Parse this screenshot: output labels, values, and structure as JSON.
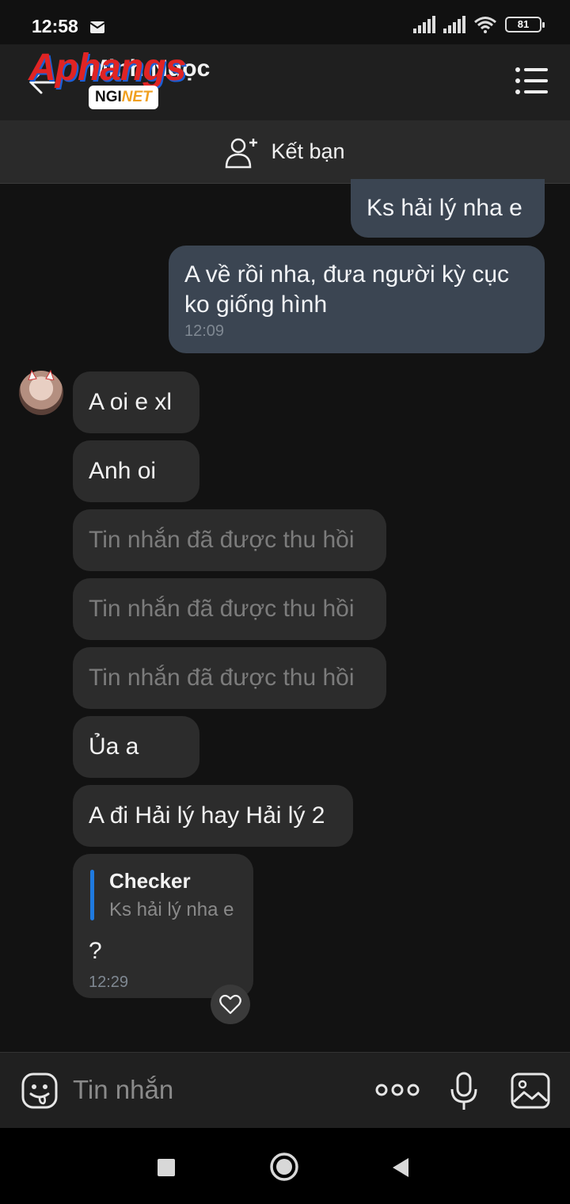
{
  "status": {
    "time": "12:58",
    "battery": "81"
  },
  "header": {
    "contact_name": "Minh Ngọc",
    "watermark": "Aphangs",
    "watermark_badge_prefix": "NGI",
    "watermark_badge_suffix": "NET"
  },
  "friend_bar": {
    "label": "Kết bạn"
  },
  "messages": [
    {
      "dir": "out",
      "text": "Ks hải lý nha e"
    },
    {
      "dir": "out",
      "text": "A về rồi nha, đưa người kỳ cục ko giống hình",
      "time": "12:09"
    },
    {
      "dir": "in",
      "text": "A oi e xl"
    },
    {
      "dir": "in",
      "text": "Anh oi"
    },
    {
      "dir": "in",
      "text": "Tin nhắn đã được thu hồi",
      "recalled": true
    },
    {
      "dir": "in",
      "text": "Tin nhắn đã được thu hồi",
      "recalled": true
    },
    {
      "dir": "in",
      "text": "Tin nhắn đã được thu hồi",
      "recalled": true
    },
    {
      "dir": "in",
      "text": "Ủa a"
    },
    {
      "dir": "in",
      "text": "A đi Hải lý hay Hải lý 2"
    },
    {
      "dir": "in",
      "quote_author": "Checker",
      "quote_text": "Ks hải lý nha e",
      "text": "?",
      "time": "12:29"
    }
  ],
  "composer": {
    "placeholder": "Tin nhắn"
  },
  "colors": {
    "outgoing_bubble": "#3b4552",
    "incoming_bubble": "#2c2c2c",
    "quote_accent": "#1f7ae0",
    "background": "#121212"
  }
}
